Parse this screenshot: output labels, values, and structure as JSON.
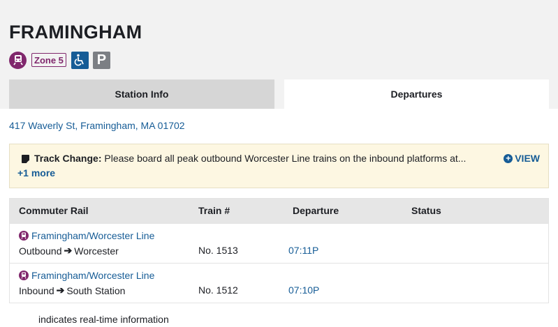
{
  "station": {
    "name": "FRAMINGHAM",
    "zone_label": "Zone 5",
    "parking_label": "P",
    "address": "417 Waverly St, Framingham, MA 01702"
  },
  "tabs": [
    {
      "label": "Station Info",
      "active": false
    },
    {
      "label": "Departures",
      "active": true
    }
  ],
  "alert": {
    "title": "Track Change:",
    "text": " Please board all peak outbound Worcester Line trains on the inbound platforms at...",
    "more": "+1 more",
    "view_label": "VIEW"
  },
  "table": {
    "headers": [
      "Commuter Rail",
      "Train #",
      "Departure",
      "Status"
    ],
    "rows": [
      {
        "route": "Framingham/Worcester Line",
        "direction": "Outbound",
        "destination": "Worcester",
        "train": "No. 1513",
        "departure": "07:11P",
        "status": ""
      },
      {
        "route": "Framingham/Worcester Line",
        "direction": "Inbound",
        "destination": "South Station",
        "train": "No. 1512",
        "departure": "07:10P",
        "status": ""
      }
    ]
  },
  "legend": "indicates real-time information",
  "colors": {
    "commuter_rail": "#80276c",
    "link": "#165c96",
    "accessible": "#165c96",
    "parking": "#7c7f84",
    "alert_bg": "#fdf7e2"
  },
  "icons": [
    "commuter-rail-icon",
    "accessible-icon",
    "parking-icon",
    "alert-icon",
    "plus-circle-icon",
    "arrow-right-icon"
  ]
}
